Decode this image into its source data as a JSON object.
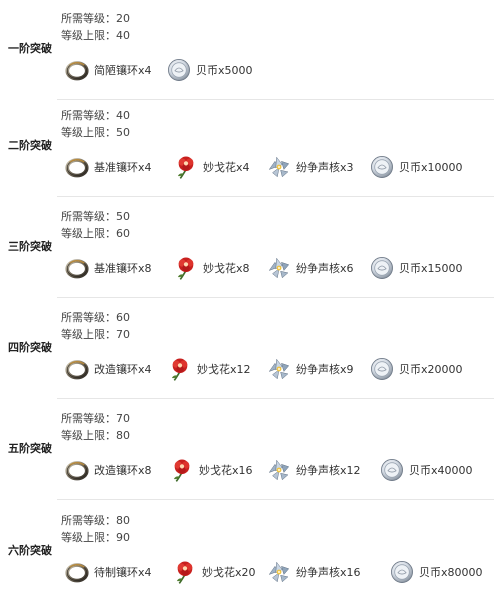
{
  "tiers": [
    {
      "name": "一阶突破",
      "level_req": "所需等级：20",
      "level_cap": "等级上限：40",
      "items": [
        {
          "icon": "ring-icon",
          "label": "简陋镶环x4"
        },
        {
          "icon": "shell-coin-icon",
          "label": "贝币x5000"
        }
      ]
    },
    {
      "name": "二阶突破",
      "level_req": "所需等级：40",
      "level_cap": "等级上限：50",
      "items": [
        {
          "icon": "ring-icon",
          "label": "基准镶环x4"
        },
        {
          "icon": "flower-icon",
          "label": "妙戈花x4"
        },
        {
          "icon": "crystal-core-icon",
          "label": "纷争声核x3"
        },
        {
          "icon": "shell-coin-icon",
          "label": "贝币x10000"
        }
      ]
    },
    {
      "name": "三阶突破",
      "level_req": "所需等级：50",
      "level_cap": "等级上限：60",
      "items": [
        {
          "icon": "ring-icon",
          "label": "基准镶环x8"
        },
        {
          "icon": "flower-icon",
          "label": "妙戈花x8"
        },
        {
          "icon": "crystal-core-icon",
          "label": "纷争声核x6"
        },
        {
          "icon": "shell-coin-icon",
          "label": "贝币x15000"
        }
      ]
    },
    {
      "name": "四阶突破",
      "level_req": "所需等级：60",
      "level_cap": "等级上限：70",
      "items": [
        {
          "icon": "ring-icon",
          "label": "改造镶环x4"
        },
        {
          "icon": "flower-icon",
          "label": "妙戈花x12"
        },
        {
          "icon": "crystal-core-icon",
          "label": "纷争声核x9"
        },
        {
          "icon": "shell-coin-icon",
          "label": "贝币x20000"
        }
      ]
    },
    {
      "name": "五阶突破",
      "level_req": "所需等级：70",
      "level_cap": "等级上限：80",
      "items": [
        {
          "icon": "ring-icon",
          "label": "改造镶环x8"
        },
        {
          "icon": "flower-icon",
          "label": "妙戈花x16"
        },
        {
          "icon": "crystal-core-icon",
          "label": "纷争声核x12"
        },
        {
          "icon": "shell-coin-icon",
          "label": "贝币x40000"
        }
      ]
    },
    {
      "name": "六阶突破",
      "level_req": "所需等级：80",
      "level_cap": "等级上限：90",
      "items": [
        {
          "icon": "ring-icon",
          "label": "待制镶环x4"
        },
        {
          "icon": "flower-icon",
          "label": "妙戈花x20"
        },
        {
          "icon": "crystal-core-icon",
          "label": "纷争声核x16"
        },
        {
          "icon": "shell-coin-icon",
          "label": "贝币x80000"
        }
      ]
    }
  ]
}
